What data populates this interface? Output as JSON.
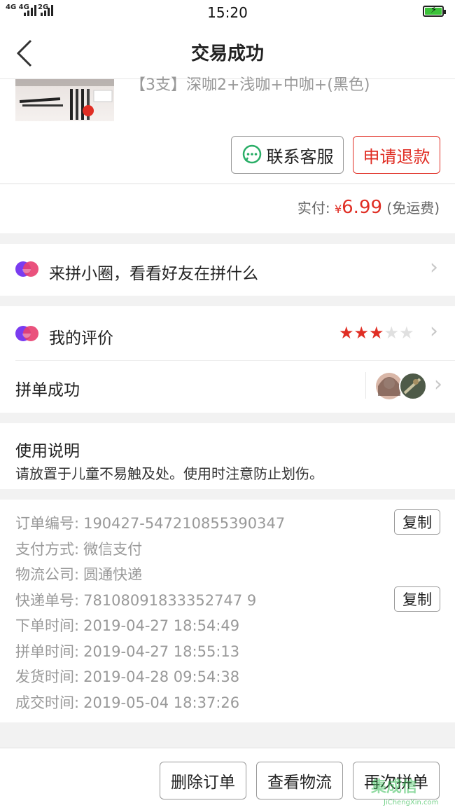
{
  "status_bar": {
    "network": "4G 4G",
    "network2": "2G",
    "time": "15:20"
  },
  "header": {
    "title": "交易成功"
  },
  "product": {
    "name": "【3支】深咖2+浅咖+中咖+(黑色)"
  },
  "actions": {
    "contact": "联系客服",
    "refund": "申请退款"
  },
  "payment": {
    "label": "实付:",
    "currency": "¥",
    "amount": "6.99",
    "shipping": "(免运费)"
  },
  "circle": {
    "label": "来拼小圈，看看好友在拼什么"
  },
  "review": {
    "label": "我的评价",
    "rating": 3,
    "max_rating": 5
  },
  "group": {
    "label": "拼单成功"
  },
  "usage": {
    "title": "使用说明",
    "text": "请放置于儿童不易触及处。使用时注意防止划伤。"
  },
  "order_info": [
    {
      "label": "订单编号:",
      "value": "190427-547210855390347",
      "copy": "复制"
    },
    {
      "label": "支付方式:",
      "value": "微信支付"
    },
    {
      "label": "物流公司:",
      "value": "圆通快递"
    },
    {
      "label": "快递单号:",
      "value": "78108091833352747 9",
      "copy": "复制"
    },
    {
      "label": "下单时间:",
      "value": "2019-04-27 18:54:49"
    },
    {
      "label": "拼单时间:",
      "value": "2019-04-27 18:55:13"
    },
    {
      "label": "发货时间:",
      "value": "2019-04-28 09:54:38"
    },
    {
      "label": "成交时间:",
      "value": "2019-05-04 18:37:26"
    }
  ],
  "bottom": {
    "delete": "删除订单",
    "logistics": "查看物流",
    "again": "再次拼单"
  },
  "watermark": {
    "text": "集成信",
    "url": "JiChengXin.com"
  },
  "colors": {
    "accent": "#e02e24",
    "wechat": "#2aae67",
    "star_off": "#e0e0e0"
  }
}
